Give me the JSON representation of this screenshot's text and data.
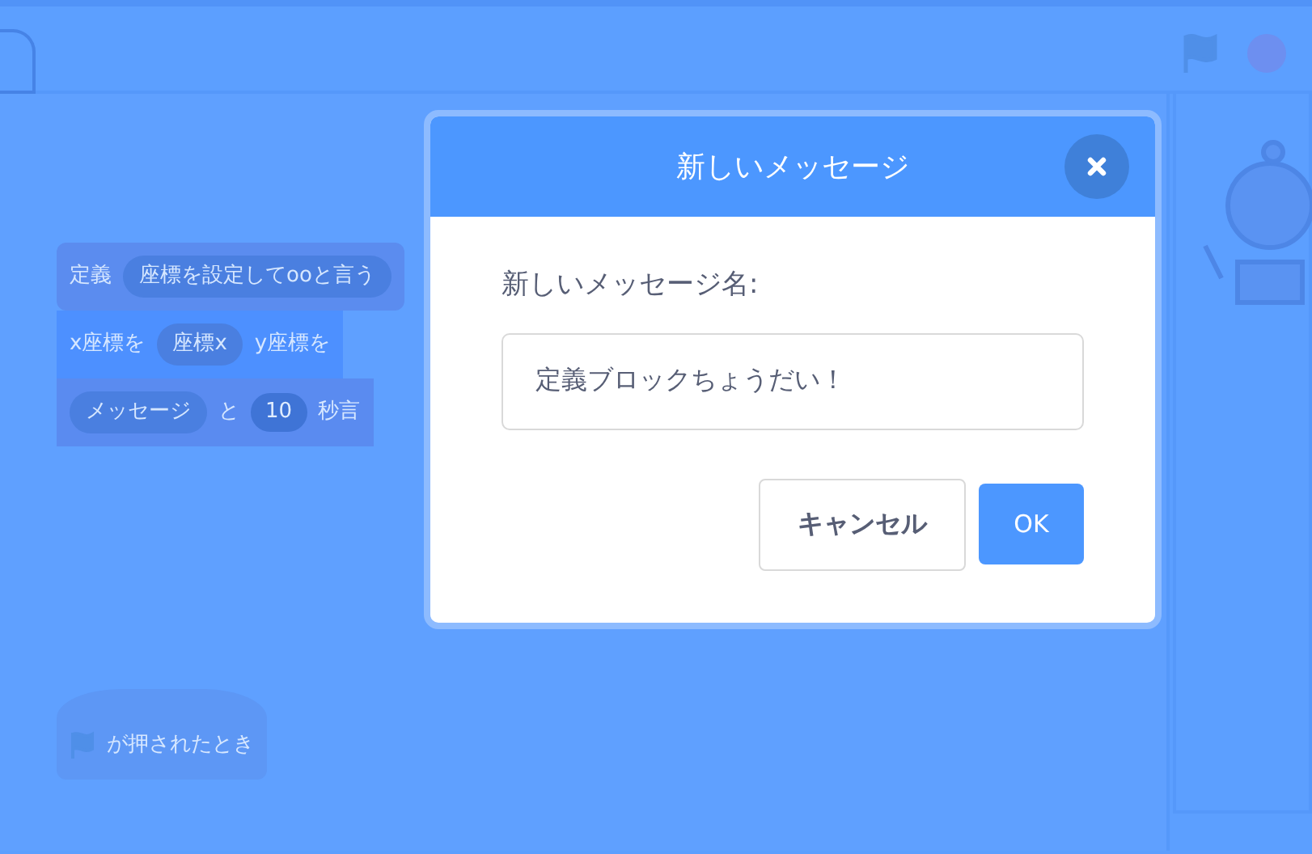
{
  "code_area": {
    "scripts": [
      {
        "kind": "define",
        "rows": [
          {
            "kind": "custom",
            "parts": [
              {
                "kind": "text",
                "text": "定義"
              },
              {
                "kind": "slot",
                "text": "座標を設定してooと言う"
              }
            ]
          },
          {
            "kind": "motion",
            "parts": [
              {
                "kind": "text",
                "text": "x座標を"
              },
              {
                "kind": "slot",
                "text": "座標x"
              },
              {
                "kind": "text",
                "text": "y座標を"
              }
            ]
          },
          {
            "kind": "looks",
            "parts": [
              {
                "kind": "slot",
                "text": "メッセージ"
              },
              {
                "kind": "text",
                "text": "と"
              },
              {
                "kind": "number",
                "text": "10"
              },
              {
                "kind": "text",
                "text": "秒言"
              }
            ]
          }
        ]
      },
      {
        "kind": "hat",
        "rows": [
          {
            "kind": "events",
            "parts": [
              {
                "kind": "flag"
              },
              {
                "kind": "text",
                "text": "が押されたとき"
              }
            ]
          }
        ]
      }
    ]
  },
  "dialog": {
    "title": "新しいメッセージ",
    "label": "新しいメッセージ名:",
    "field": {
      "value": "定義ブロックちょうだい！"
    },
    "buttons": [
      {
        "label": "キャンセル",
        "kind": "secondary"
      },
      {
        "label": "OK",
        "kind": "primary"
      }
    ]
  }
}
